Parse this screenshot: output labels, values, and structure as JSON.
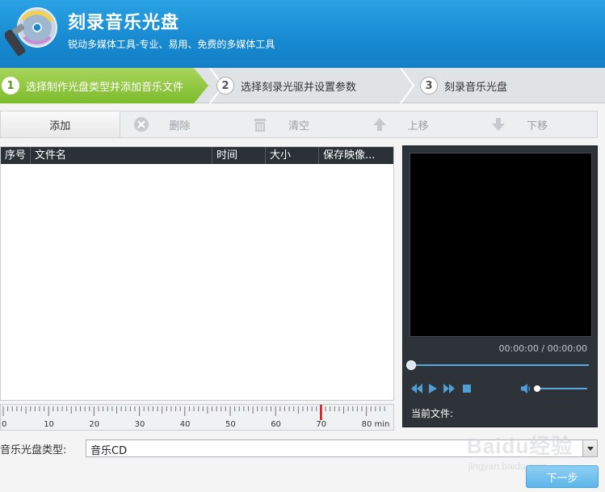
{
  "header": {
    "title": "刻录音乐光盘",
    "subtitle": "锐动多媒体工具-专业、易用、免费的多媒体工具",
    "logo_icon": "disc-torch-icon"
  },
  "steps": [
    {
      "num": "1",
      "label": "选择制作光盘类型并添加音乐文件",
      "active": true
    },
    {
      "num": "2",
      "label": "选择刻录光驱并设置参数",
      "active": false
    },
    {
      "num": "3",
      "label": "刻录音乐光盘",
      "active": false
    }
  ],
  "toolbar": {
    "add": "添加",
    "delete": "删除",
    "clear": "清空",
    "move_up": "上移",
    "move_down": "下移"
  },
  "list": {
    "columns": [
      "序号",
      "文件名",
      "时间",
      "大小",
      "保存映像..."
    ],
    "rows": []
  },
  "ruler": {
    "ticks": [
      "0",
      "10",
      "20",
      "30",
      "40",
      "50",
      "60",
      "70",
      "80 min"
    ],
    "marker_minutes": 70
  },
  "player": {
    "time": "00:00:00 / 00:00:00",
    "current_file_label": "当前文件:",
    "seek_progress": 0
  },
  "disc_type": {
    "label": "音乐光盘类型:",
    "value": "音乐CD"
  },
  "next_button": "下一步",
  "watermark": {
    "text": "Baidu经验",
    "url": "jingyan.baidu.com"
  },
  "colors": {
    "header_blue": "#1789d0",
    "step_active_green": "#7dbb2c",
    "list_header_dark": "#2b3136",
    "accent_blue": "#5aa9dc",
    "ruler_marker": "#cc1111"
  }
}
